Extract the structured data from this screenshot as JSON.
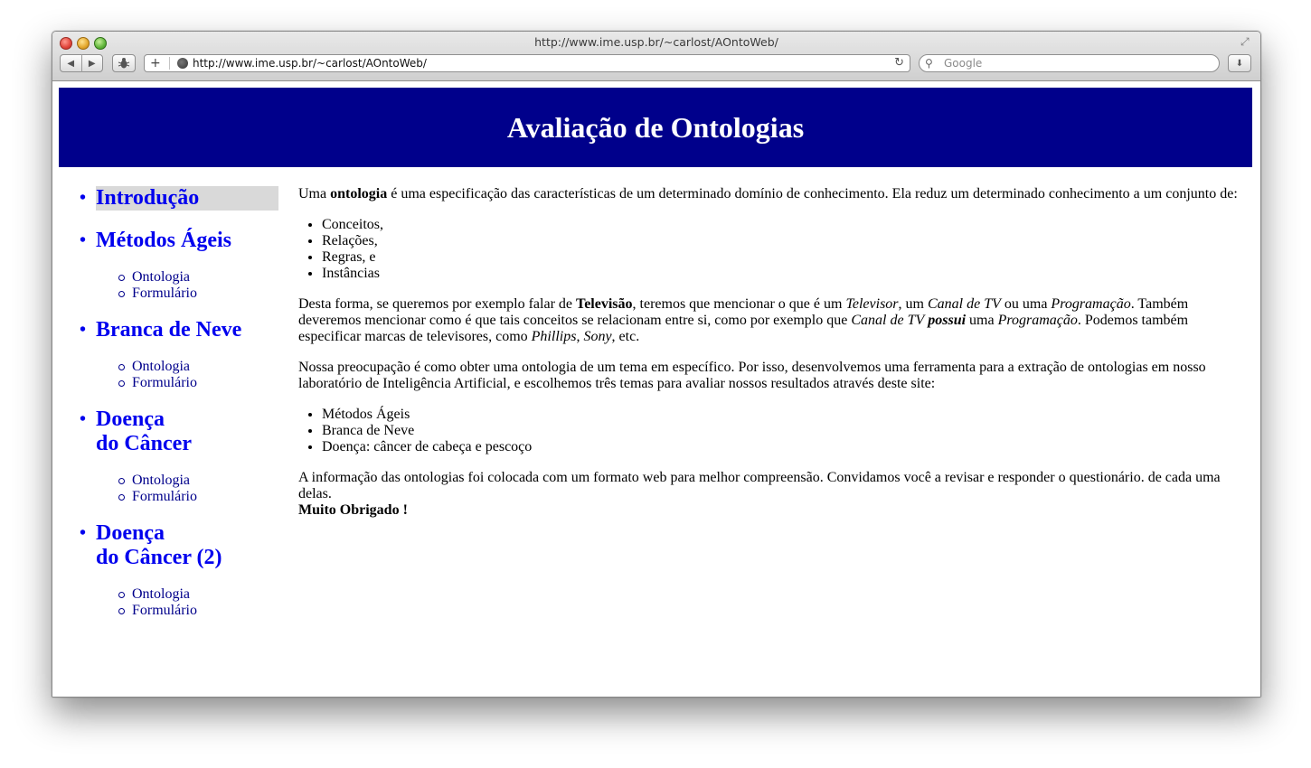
{
  "browser": {
    "window_title": "http://www.ime.usp.br/~carlost/AOntoWeb/",
    "url": "http://www.ime.usp.br/~carlost/AOntoWeb/",
    "search_placeholder": "Google"
  },
  "page": {
    "banner_title": "Avaliação de Ontologias",
    "sidebar": [
      {
        "label": "Introdução",
        "active": true,
        "sub": []
      },
      {
        "label": "Métodos Ágeis",
        "sub": [
          "Ontologia",
          "Formulário"
        ]
      },
      {
        "label": "Branca de Neve",
        "sub": [
          "Ontologia",
          "Formulário"
        ]
      },
      {
        "label_line1": "Doença",
        "label_line2": "do Câncer",
        "sub": [
          "Ontologia",
          "Formulário"
        ]
      },
      {
        "label_line1": "Doença",
        "label_line2": "do Câncer (2)",
        "sub": [
          "Ontologia",
          "Formulário"
        ]
      }
    ],
    "content": {
      "p1": {
        "a": "Uma ",
        "b": "ontologia",
        "c": " é uma especificação das características de um determinado domínio de conhecimento. Ela reduz um determinado conhecimento a um conjunto de:"
      },
      "list1": [
        "Conceitos,",
        "Relações,",
        "Regras, e",
        "Instâncias"
      ],
      "p2": {
        "a": "Desta forma, se queremos por exemplo falar de ",
        "b": "Televisão",
        "c": ", teremos que mencionar o que é um ",
        "d": "Televisor",
        "e": ", um ",
        "f": "Canal de TV",
        "g": " ou uma ",
        "h": "Programação",
        "i": ". Também deveremos mencionar como é que tais conceitos se relacionam entre si, como por exemplo que ",
        "j": "Canal de TV",
        "k": " ",
        "l": "possui",
        "m": " uma ",
        "n": "Programação",
        "o": ". Podemos também especificar marcas de televisores, como ",
        "p": "Phillips",
        "q": ", ",
        "r": "Sony",
        "s": ", etc."
      },
      "p3": "Nossa preocupação é como obter uma ontologia de um tema em específico. Por isso, desenvolvemos uma ferramenta para a extração de ontologias em nosso laboratório de Inteligência Artificial, e escolhemos três temas para avaliar nossos resultados através deste site:",
      "list2": [
        "Métodos Ágeis",
        "Branca de Neve",
        "Doença: câncer de cabeça e pescoço"
      ],
      "p4": "A informação das ontologias foi colocada com um formato web para melhor compreensão. Convidamos você a revisar e responder o questionário. de cada uma delas.",
      "thanks": "Muito Obrigado !"
    }
  },
  "icons": {
    "back": "◀",
    "forward": "▶",
    "plus": "+",
    "reload": "↻",
    "search": "⚲",
    "download": "⬇",
    "resize": "⤢"
  }
}
